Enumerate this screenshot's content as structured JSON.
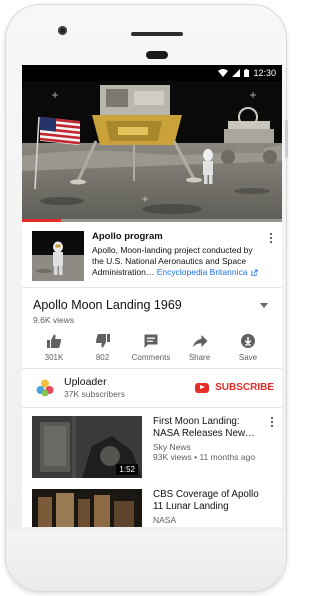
{
  "status_bar": {
    "time": "12:30"
  },
  "video": {
    "progress_fraction": 0.15
  },
  "info_card": {
    "title": "Apollo program",
    "description": "Apollo, Moon-landing project conducted by the U.S. National Aeronautics and Space Administration…",
    "link": "Encyclopedia Britannica"
  },
  "video_info": {
    "title": "Apollo Moon Landing 1969",
    "views": "9.6K views"
  },
  "actions": [
    {
      "icon": "thumbs-up-icon",
      "label": "301K"
    },
    {
      "icon": "thumbs-down-icon",
      "label": "802"
    },
    {
      "icon": "comments-icon",
      "label": "Comments"
    },
    {
      "icon": "share-icon",
      "label": "Share"
    },
    {
      "icon": "save-icon",
      "label": "Save"
    }
  ],
  "channel": {
    "name": "Uploader",
    "subscribers": "37K subscribers",
    "subscribe_label": "SUBSCRIBE"
  },
  "related": [
    {
      "title": "First Moon Landing: NASA Releases New…",
      "channel": "Sky News",
      "meta": "93K views • 11 months ago",
      "duration": "1:52"
    },
    {
      "title": "CBS Coverage of Apollo 11 Lunar Landing",
      "channel": "NASA",
      "meta": "",
      "duration": ""
    }
  ],
  "colors": {
    "accent": "#e52d27",
    "link": "#1a73e8",
    "text_secondary": "#606060"
  }
}
